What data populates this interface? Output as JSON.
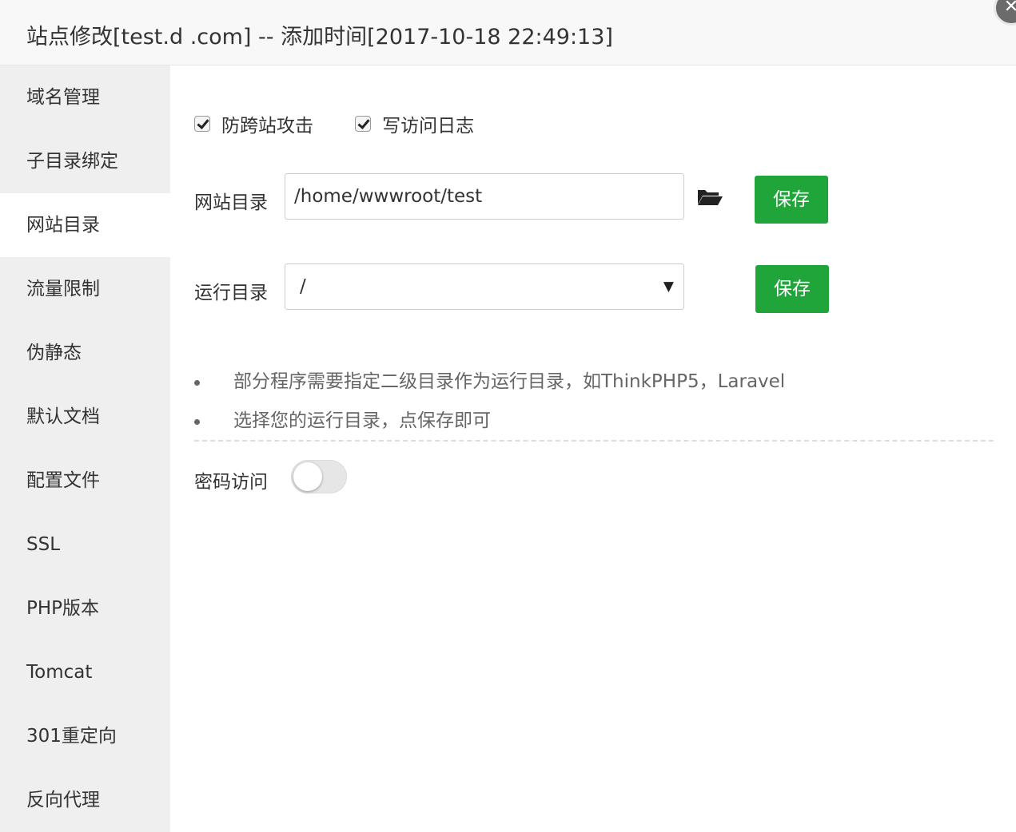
{
  "window": {
    "title": "站点修改[test.d        .com] -- 添加时间[2017-10-18 22:49:13]",
    "close_icon": "close-icon"
  },
  "sidebar": {
    "items": [
      {
        "label": "域名管理",
        "active": false
      },
      {
        "label": "子目录绑定",
        "active": false
      },
      {
        "label": "网站目录",
        "active": true
      },
      {
        "label": "流量限制",
        "active": false
      },
      {
        "label": "伪静态",
        "active": false
      },
      {
        "label": "默认文档",
        "active": false
      },
      {
        "label": "配置文件",
        "active": false
      },
      {
        "label": "SSL",
        "active": false
      },
      {
        "label": "PHP版本",
        "active": false
      },
      {
        "label": "Tomcat",
        "active": false
      },
      {
        "label": "301重定向",
        "active": false
      },
      {
        "label": "反向代理",
        "active": false
      }
    ]
  },
  "main": {
    "checkboxes": [
      {
        "label": "防跨站攻击",
        "checked": true
      },
      {
        "label": "写访问日志",
        "checked": true
      }
    ],
    "site_dir": {
      "label": "网站目录",
      "value": "/home/wwwroot/test",
      "icon": "folder-open-icon",
      "save_label": "保存"
    },
    "run_dir": {
      "label": "运行目录",
      "value": "/",
      "save_label": "保存"
    },
    "tips": [
      "部分程序需要指定二级目录作为运行目录，如ThinkPHP5，Laravel",
      "选择您的运行目录，点保存即可"
    ],
    "password_access": {
      "label": "密码访问",
      "enabled": false
    }
  },
  "colors": {
    "accent": "#20a53a",
    "sidebar_bg": "#efefef"
  }
}
